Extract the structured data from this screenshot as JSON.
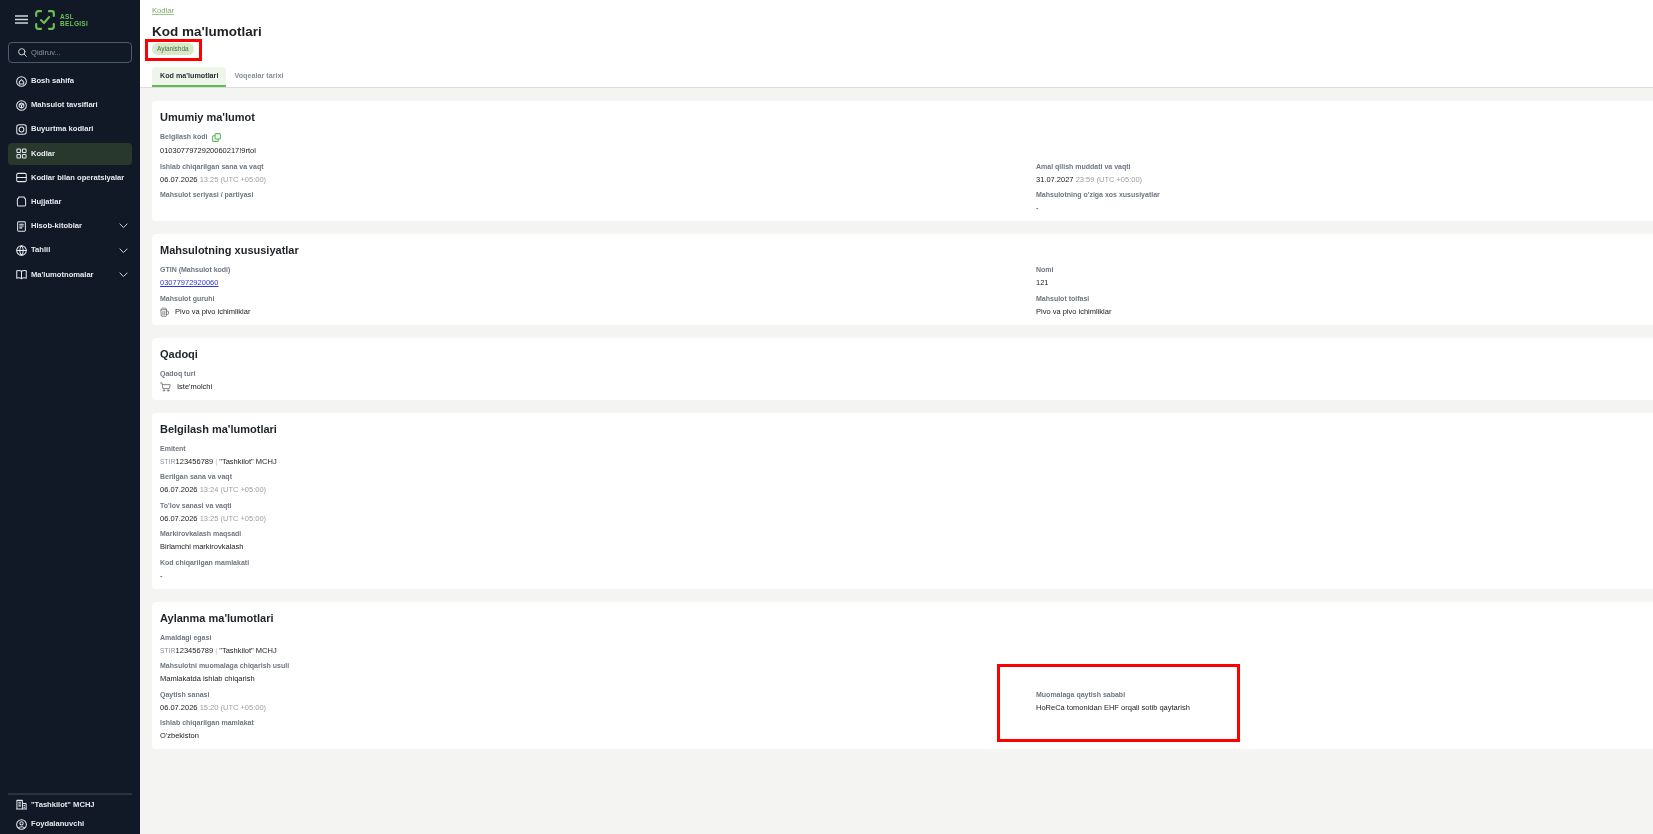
{
  "sidebar": {
    "logo": [
      "ASL",
      "BELGISI"
    ],
    "search": {
      "placeholder": "Qidiruv..."
    },
    "items": [
      {
        "label": "Bosh sahifa",
        "selected": false
      },
      {
        "label": "Mahsulot tavsiflari",
        "selected": false
      },
      {
        "label": "Buyurtma kodlari",
        "selected": false
      },
      {
        "label": "Kodlar",
        "selected": true
      },
      {
        "label": "Kodlar bilan operatsiyalar",
        "selected": false
      },
      {
        "label": "Hujjatlar",
        "selected": false
      },
      {
        "label": "Hisob-kitoblar",
        "selected": false,
        "expanded": false
      },
      {
        "label": "Tahlil",
        "selected": false,
        "expanded": false
      },
      {
        "label": "Ma'lumotnomalar",
        "selected": false,
        "expanded": false
      }
    ],
    "footer": [
      {
        "label": "\"Tashkilot\" MCHJ"
      },
      {
        "label": "Foydalanuvchi"
      }
    ]
  },
  "breadcrumb": [
    "Kodlar"
  ],
  "header": {
    "title": "Kod ma'lumotlari",
    "status": {
      "label": "Aylanishda",
      "highlighted": true
    }
  },
  "tabs": [
    {
      "label": "Kod ma'lumotlari",
      "selected": true
    },
    {
      "label": "Voqealar tarixi",
      "selected": false
    }
  ],
  "cards": [
    {
      "title": "Umumiy ma'lumot",
      "rows": [
        [
          {
            "kind": "copyable",
            "label": "Belgilash kodi",
            "value": "0103077972920060217!9rtol"
          }
        ],
        [
          {
            "kind": "datetime",
            "label": "Ishlab chiqarilgan sana va vaqt",
            "date": "06.07.2026",
            "time": "13:25",
            "zone": "(UTC +05:00)"
          },
          {
            "kind": "datetime",
            "label": "Amal qilish muddati va vaqti",
            "date": "31.07.2027",
            "time": "23:59",
            "zone": "(UTC +05:00)"
          }
        ],
        [
          {
            "kind": "text",
            "label": "Mahsulot seriyasi / partiyasi"
          },
          {
            "kind": "text",
            "label": "Mahsulotning o'ziga xos xususiyatlar",
            "value": "-"
          }
        ]
      ]
    },
    {
      "title": "Mahsulotning xususiyatlar",
      "rows": [
        [
          {
            "kind": "link",
            "label": "GTIN (Mahsulot kodi)",
            "value": "03077972920060"
          },
          {
            "kind": "text",
            "label": "Nomi",
            "value": "121"
          }
        ],
        [
          {
            "kind": "group",
            "label": "Mahsulot guruhi",
            "value": "Pivo va pivo ichimliklar"
          },
          {
            "kind": "text",
            "label": "Mahsulot toifasi",
            "value": "Pivo va pivo ichimliklar"
          }
        ]
      ]
    },
    {
      "title": "Qadoqi",
      "rows": [
        [
          {
            "kind": "package",
            "label": "Qadoq turi",
            "value": "Iste'molchi"
          }
        ]
      ]
    },
    {
      "title": "Belgilash ma'lumotlari",
      "rows": [
        [
          {
            "kind": "organization",
            "label": "Emitent",
            "prefix": "STIR",
            "tin": "123456789",
            "separator": "|",
            "name": "\"Tashkilot\" MCHJ"
          }
        ],
        [
          {
            "kind": "datetime",
            "label": "Berilgan sana va vaqt",
            "date": "06.07.2026",
            "time": "13:24",
            "zone": "(UTC +05:00)"
          }
        ],
        [
          {
            "kind": "datetime",
            "label": "To'lov sanasi va vaqti",
            "date": "06.07.2026",
            "time": "13:25",
            "zone": "(UTC +05:00)"
          }
        ],
        [
          {
            "kind": "text",
            "label": "Markirovkalash maqsadi",
            "value": "Birlamchi markirovkalash"
          }
        ],
        [
          {
            "kind": "text",
            "label": "Kod chiqarilgan mamlakati",
            "value": "-"
          }
        ]
      ]
    },
    {
      "title": "Aylanma ma'lumotlari",
      "rows": [
        [
          {
            "kind": "organization",
            "label": "Amaldagi egasi",
            "prefix": "STIR",
            "tin": "123456789",
            "separator": "|",
            "name": "\"Tashkilot\" MCHJ"
          }
        ],
        [
          {
            "kind": "text",
            "label": "Mahsulotni muomalaga chiqarish usuli",
            "value": "Mamlakatda ishlab chiqarish"
          }
        ],
        [
          {
            "kind": "datetime",
            "label": "Qaytish sanasi",
            "date": "06.07.2026",
            "time": "15:20",
            "zone": "(UTC +05:00)"
          },
          {
            "kind": "text",
            "label": "Muomalaga qaytish sababi",
            "value": "HoReCa tomonidan EHF orqali sotib qaytarish",
            "highlighted": true
          }
        ],
        [
          {
            "kind": "text",
            "label": "Ishlab chiqarilgan mamlakat",
            "value": "O'zbekiston"
          }
        ]
      ]
    }
  ]
}
